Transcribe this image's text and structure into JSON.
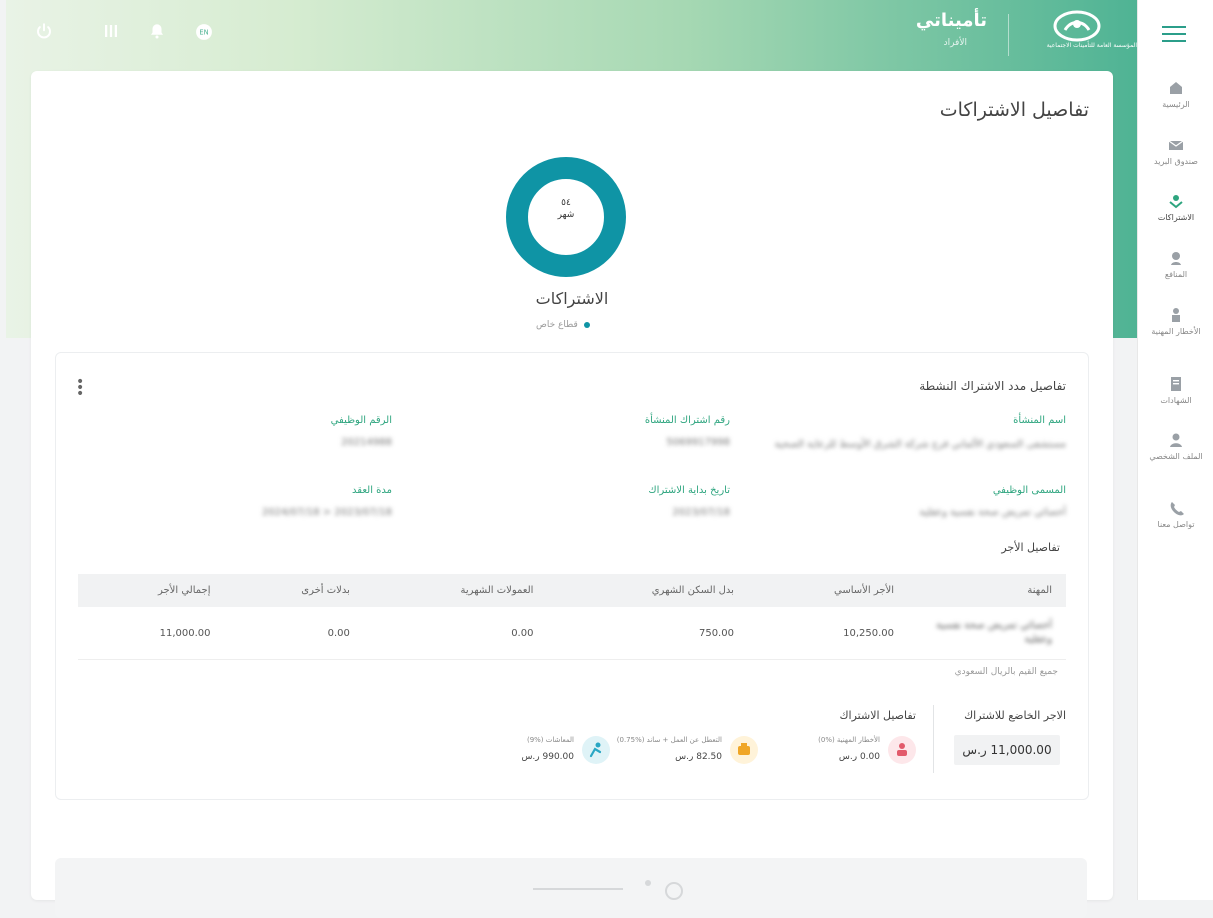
{
  "header": {
    "brand_name": "تأميناتي",
    "brand_sub": "الأفراد",
    "org_name": "المؤسسة العامة للتأمينات الاجتماعية"
  },
  "colors": {
    "accent": "#2ea57f",
    "donut": "#0f94a5",
    "brand_green": "#4fb394"
  },
  "sidebar": {
    "items": [
      {
        "label": "الرئيسية",
        "icon": "home-icon"
      },
      {
        "label": "صندوق البريد",
        "icon": "mail-icon"
      },
      {
        "label": "الاشتراكات",
        "icon": "subscriptions-icon"
      },
      {
        "label": "المنافع",
        "icon": "benefits-icon"
      },
      {
        "label": "الأخطار المهنية",
        "icon": "occupational-icon"
      },
      {
        "label": "الشهادات",
        "icon": "certificates-icon"
      },
      {
        "label": "الملف الشخصي",
        "icon": "profile-icon"
      },
      {
        "label": "تواصل معنا",
        "icon": "contact-icon"
      }
    ]
  },
  "page": {
    "title": "تفاصيل الاشتراكات",
    "donut_value": "٥٤",
    "donut_unit": "شهر",
    "donut_caption": "الاشتراكات",
    "legend_label": "قطاع خاص"
  },
  "details": {
    "title": "تفاصيل مدد الاشتراك النشطة",
    "fields": {
      "establishment_name_label": "اسم المنشأة",
      "establishment_name_value": "مستشفى السعودي الألماني فرع شركة الشرق الأوسط للرعاية الصحية",
      "establishment_sub_label": "رقم اشتراك المنشأة",
      "establishment_sub_value": "5069917998",
      "employee_no_label": "الرقم الوظيفي",
      "employee_no_value": "20214988",
      "job_title_label": "المسمى الوظيفي",
      "job_title_value": "أخصائي تمريض صحة نفسية وعقلية",
      "start_date_label": "تاريخ بداية الاشتراك",
      "start_date_value": "2023/07/18",
      "contract_label": "مدة العقد",
      "contract_value": "2024/07/18 > 2023/07/18"
    },
    "wages_title": "تفاصيل الأجر",
    "table": {
      "headers": [
        "المهنة",
        "الأجر الأساسي",
        "بدل السكن الشهري",
        "العمولات الشهرية",
        "بدلات أخرى",
        "إجمالي الأجر"
      ],
      "rows": [
        [
          "أخصائي تمريض صحة نفسية وعقلية",
          "10,250.00",
          "750.00",
          "0.00",
          "0.00",
          "11,000.00"
        ]
      ]
    },
    "note": "جميع القيم بالريال السعودي",
    "subject_wage_label": "الاجر الخاضع للاشتراك",
    "subject_wage_value": "11,000.00 ر.س",
    "sub_details_title": "تفاصيل الاشتراك",
    "contributions": [
      {
        "label": "الأخطار المهنية (%0)",
        "value": "0.00 ر.س",
        "icon": "hazard-icon"
      },
      {
        "label": "التعطل عن العمل + ساند (%0.75)",
        "value": "82.50 ر.س",
        "icon": "unemployment-icon"
      },
      {
        "label": "المعاشات (%9)",
        "value": "990.00 ر.س",
        "icon": "pension-icon"
      }
    ]
  }
}
